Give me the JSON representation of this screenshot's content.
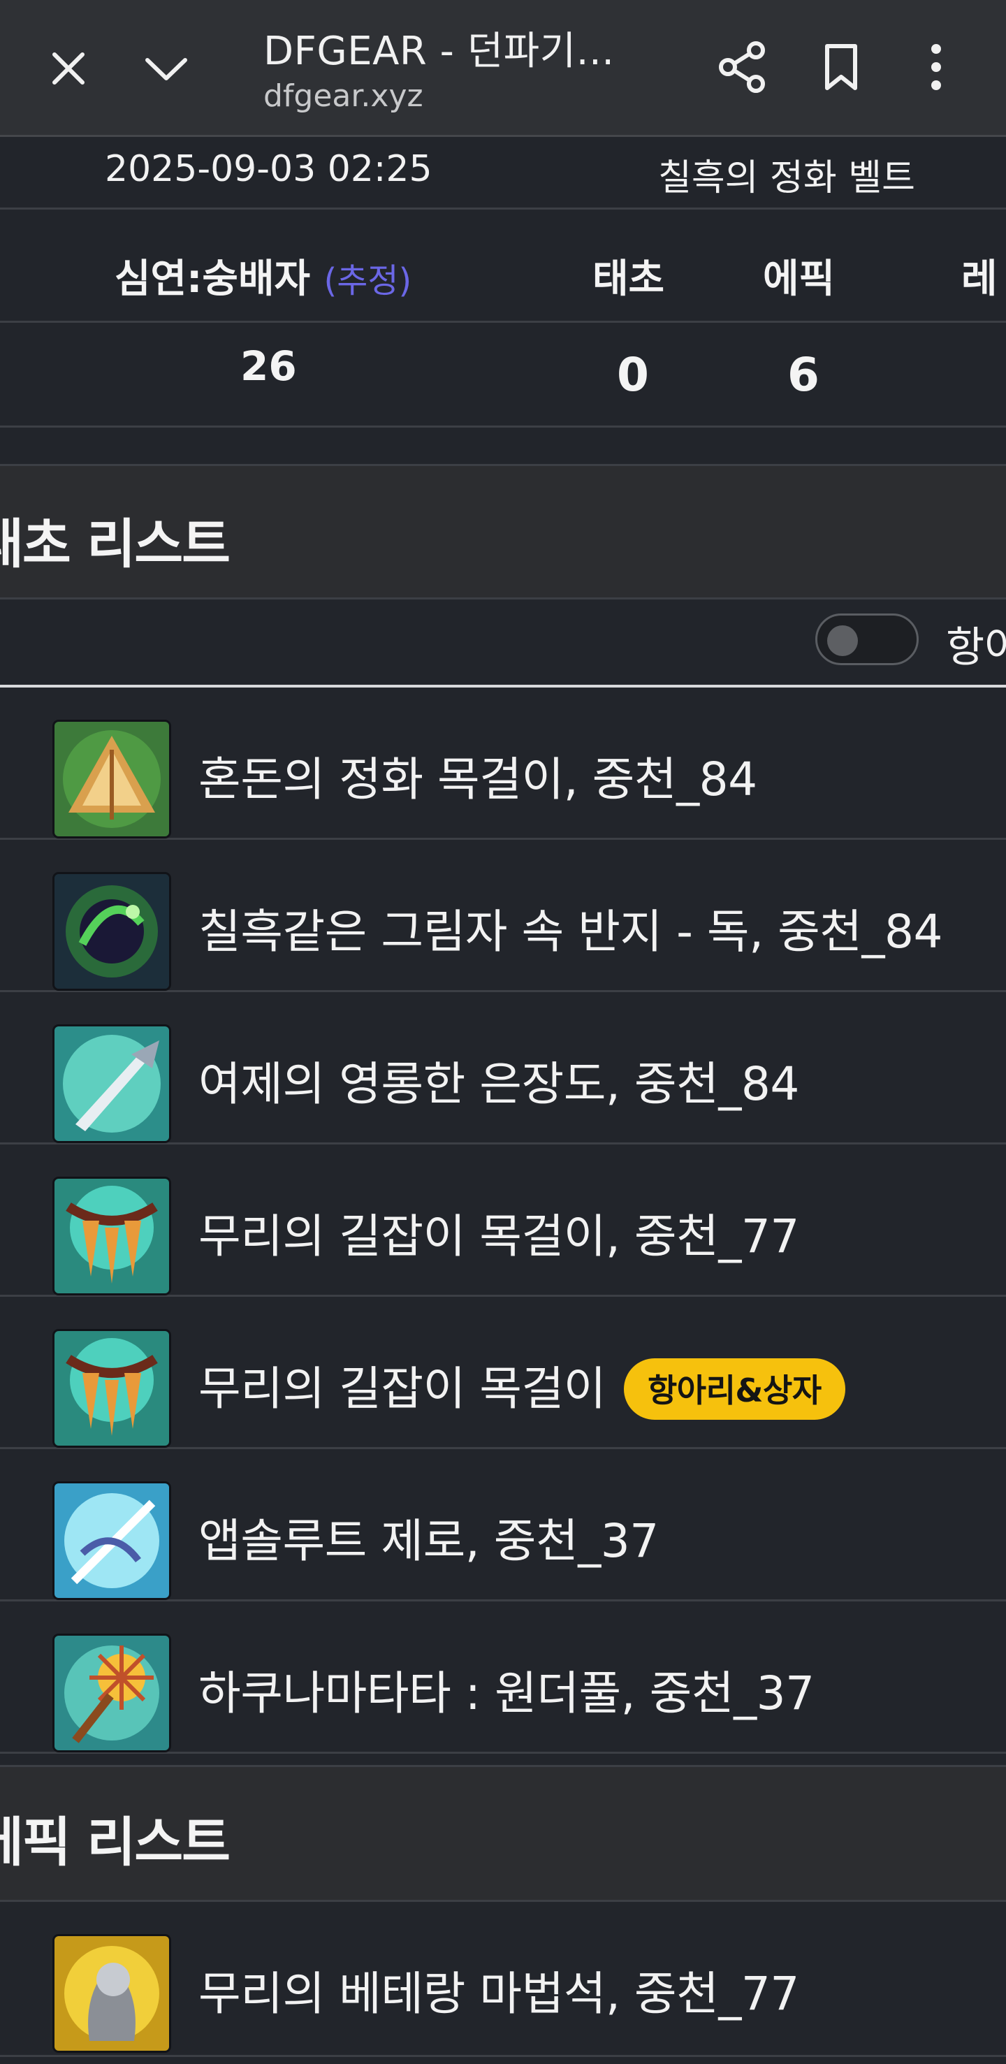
{
  "browser": {
    "title": "DFGEAR - 던파기...",
    "url": "dfgear.xyz",
    "icons": [
      "close-icon",
      "chevron-down-icon",
      "share-icon",
      "bookmark-icon",
      "more-vert-icon"
    ]
  },
  "summary": {
    "date": "2025-09-03 02:25",
    "item": "칠흑의 정화 벨트",
    "headers": {
      "dungeon": "심연:숭배자",
      "estimate": "(추정)",
      "taecho": "태초",
      "epic": "에픽",
      "legendary": "레"
    },
    "values": {
      "dungeon": "26",
      "taecho": "0",
      "epic": "6"
    }
  },
  "taecho_section": {
    "title": "태초 리스트",
    "toggle_label": "항아",
    "toggle_on": false
  },
  "items": [
    {
      "name": "혼돈의 정화 목걸이, 중천_84",
      "badge": ""
    },
    {
      "name": "칠흑같은 그림자 속 반지 - 독, 중천_84",
      "badge": ""
    },
    {
      "name": "여제의 영롱한 은장도, 중천_84",
      "badge": ""
    },
    {
      "name": "무리의 길잡이 목걸이, 중천_77",
      "badge": ""
    },
    {
      "name": "무리의 길잡이 목걸이",
      "badge": "항아리&상자"
    },
    {
      "name": "앱솔루트 제로, 중천_37",
      "badge": ""
    },
    {
      "name": "하쿠나마타타 : 원더풀, 중천_37",
      "badge": ""
    }
  ],
  "epic_section": {
    "title": "에픽 리스트"
  },
  "epic_items": [
    {
      "name": "무리의 베테랑 마법석, 중천_77"
    }
  ],
  "colors": {
    "background": "#22252b",
    "topbar": "#2f3135",
    "section": "#2c2d30",
    "estimate": "#6b67e6",
    "badge": "#f6c10d"
  }
}
